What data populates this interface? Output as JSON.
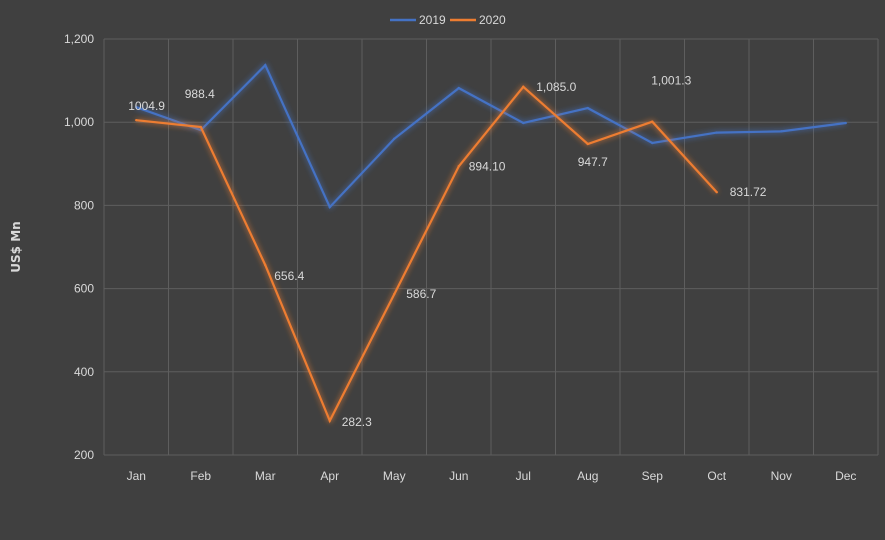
{
  "chart_data": {
    "type": "line",
    "title": "",
    "xlabel": "",
    "ylabel": "US$ Mn",
    "ylim": [
      200,
      1200
    ],
    "yticks": [
      200,
      400,
      600,
      800,
      1000,
      1200
    ],
    "ytick_labels": [
      "200",
      "400",
      "600",
      "800",
      "1,000",
      "1,200"
    ],
    "grid": true,
    "legend_position": "top-center",
    "categories": [
      "Jan",
      "Feb",
      "Mar",
      "Apr",
      "May",
      "Jun",
      "Jul",
      "Aug",
      "Sep",
      "Oct",
      "Nov",
      "Dec"
    ],
    "series": [
      {
        "name": "2019",
        "color": "#4472c4",
        "values": [
          1036,
          981,
          1137,
          796,
          960,
          1082,
          998,
          1034,
          950,
          975,
          978,
          998
        ],
        "labels": []
      },
      {
        "name": "2020",
        "color": "#ed7d31",
        "values": [
          1004.9,
          988.4,
          656.4,
          282.3,
          586.7,
          894.1,
          1085.0,
          947.7,
          1001.3,
          831.72
        ],
        "labels": [
          "1004.9",
          "988.4",
          "656.4",
          "282.3",
          "586.7",
          "894.10",
          "1,085.0",
          "947.7",
          "1,001.3",
          "831.72"
        ]
      }
    ]
  }
}
